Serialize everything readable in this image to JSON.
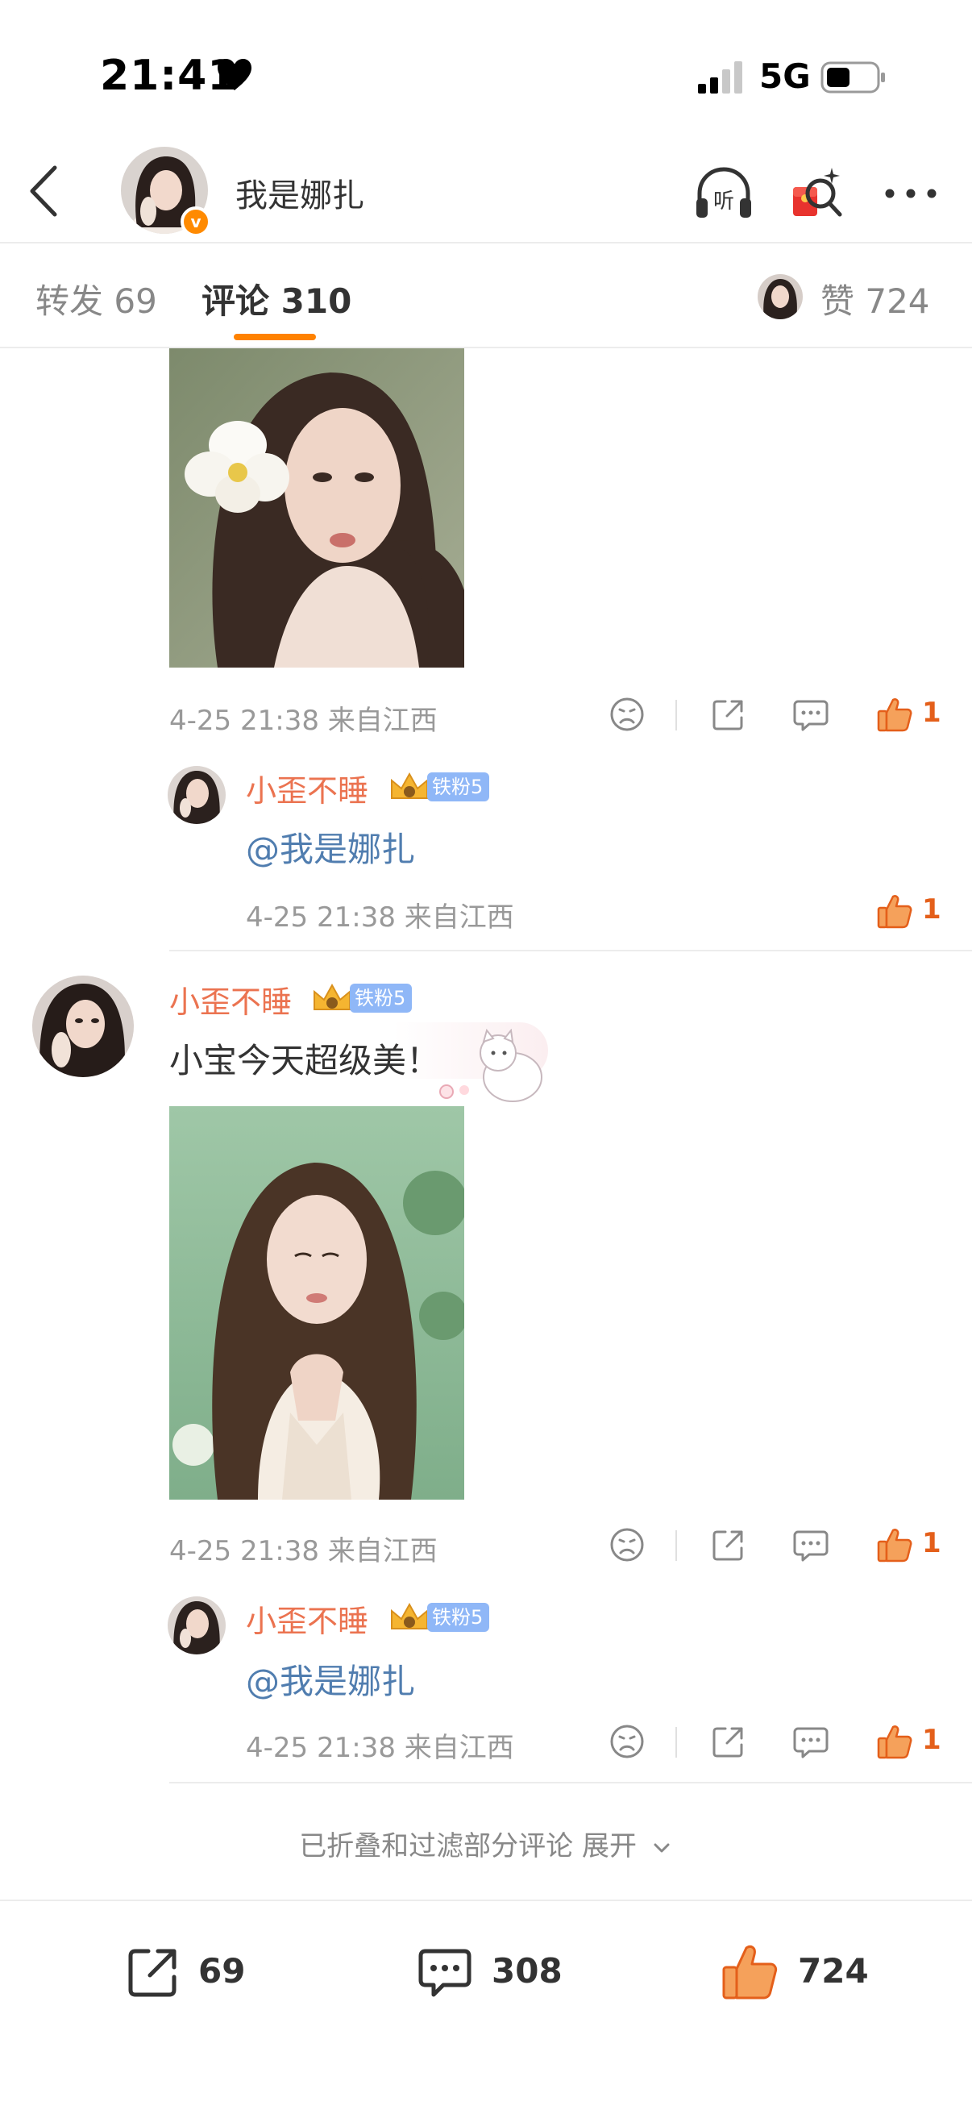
{
  "status_bar": {
    "time": "21:41",
    "network": "5G"
  },
  "header": {
    "title": "我是娜扎"
  },
  "tabs": [
    {
      "label": "转发 69"
    },
    {
      "label": "评论 310"
    },
    {
      "label": "赞 724"
    }
  ],
  "colors": {
    "accent": "#ff8200",
    "username": "#eb7350",
    "mention": "#507daf",
    "like": "#e45f1a",
    "fan_badge": "#8fb7f7"
  },
  "comments": {
    "c1": {
      "meta": "4-25 21:38  来自江西",
      "likes": "1"
    },
    "r1": {
      "user": "小歪不睡",
      "badge": "铁粉5",
      "text": "@我是娜扎",
      "meta": "4-25 21:38  来自江西",
      "likes": "1"
    },
    "c2": {
      "user": "小歪不睡",
      "badge": "铁粉5",
      "text": "小宝今天超级美！",
      "meta": "4-25 21:38  来自江西",
      "likes": "1"
    },
    "r2": {
      "user": "小歪不睡",
      "badge": "铁粉5",
      "text": "@我是娜扎",
      "meta": "4-25 21:38  来自江西",
      "likes": "1"
    }
  },
  "fold_notice": "已折叠和过滤部分评论 展开",
  "bottom_bar": {
    "reposts": "69",
    "comments": "308",
    "likes": "724"
  },
  "icons": [
    "back-icon",
    "listen-icon",
    "red-packet-icon",
    "more-icon",
    "dislike-icon",
    "share-icon",
    "comment-icon",
    "thumb-up-icon",
    "crown-icon",
    "chevron-down-icon"
  ]
}
